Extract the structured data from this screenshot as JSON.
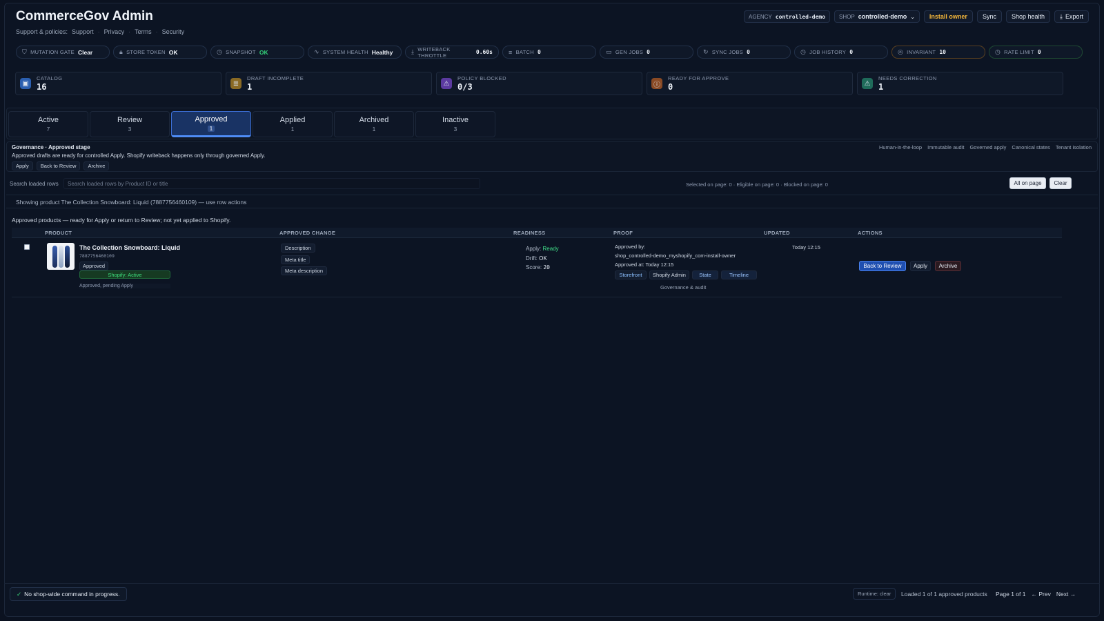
{
  "app": {
    "title": "CommerceGov Admin",
    "support_label": "Support & policies:",
    "support_links": [
      "Support",
      "Privacy",
      "Terms",
      "Security"
    ]
  },
  "header": {
    "agency_label": "AGENCY",
    "agency_value": "controlled-demo",
    "shop_label": "SHOP",
    "shop_value": "controlled-demo",
    "install_owner": "Install owner",
    "sync": "Sync",
    "shop_health": "Shop health",
    "export": "Export"
  },
  "status_chips": [
    {
      "label": "MUTATION GATE",
      "value": "Clear",
      "icon": "shield-icon",
      "style": "plain"
    },
    {
      "label": "STORE TOKEN",
      "value": "OK",
      "icon": "lock-icon",
      "style": "plain"
    },
    {
      "label": "SNAPSHOT",
      "value": "OK",
      "icon": "clock-icon",
      "style": "ok"
    },
    {
      "label": "SYSTEM HEALTH",
      "value": "Healthy",
      "icon": "pulse-icon",
      "style": "plain"
    },
    {
      "label": "WRITEBACK THROTTLE",
      "value": "0.60s",
      "icon": "download-icon",
      "style": "mono"
    },
    {
      "label": "BATCH",
      "value": "0",
      "icon": "list-icon",
      "style": "mono"
    },
    {
      "label": "GEN JOBS",
      "value": "0",
      "icon": "briefcase-icon",
      "style": "mono"
    },
    {
      "label": "SYNC JOBS",
      "value": "0",
      "icon": "refresh-icon",
      "style": "mono"
    },
    {
      "label": "JOB HISTORY",
      "value": "0",
      "icon": "clock-icon",
      "style": "mono"
    },
    {
      "label": "INVARIANT",
      "value": "10",
      "icon": "check-circle-icon",
      "style": "mono"
    },
    {
      "label": "RATE LIMIT",
      "value": "0",
      "icon": "clock-icon",
      "style": "mono"
    }
  ],
  "metrics": [
    {
      "label": "CATALOG",
      "value": "16",
      "icon": "bag-icon",
      "color": "#2b5fb0"
    },
    {
      "label": "DRAFT INCOMPLETE",
      "value": "1",
      "icon": "doc-icon",
      "color": "#8a6a24"
    },
    {
      "label": "POLICY BLOCKED",
      "value": "0/3",
      "icon": "warning-icon",
      "color": "#5b3aa0"
    },
    {
      "label": "READY FOR APPROVE",
      "value": "0",
      "icon": "alert-circle-icon",
      "color": "#8a4a24"
    },
    {
      "label": "NEEDS CORRECTION",
      "value": "1",
      "icon": "warning-icon",
      "color": "#1f6b5a"
    }
  ],
  "tabs": [
    {
      "label": "Active",
      "count": "7"
    },
    {
      "label": "Review",
      "count": "3"
    },
    {
      "label": "Approved",
      "count": "1"
    },
    {
      "label": "Applied",
      "count": "1"
    },
    {
      "label": "Archived",
      "count": "1"
    },
    {
      "label": "Inactive",
      "count": "3"
    }
  ],
  "governance": {
    "title": "Governance · Approved stage",
    "description": "Approved drafts are ready for controlled Apply. Shopify writeback happens only through governed Apply.",
    "actions": [
      "Apply",
      "Back to Review",
      "Archive"
    ],
    "tags": [
      "Human-in-the-loop",
      "Immutable audit",
      "Governed apply",
      "Canonical states",
      "Tenant isolation"
    ]
  },
  "search": {
    "label": "Search loaded rows",
    "placeholder": "Search loaded rows by Product ID or title",
    "value": "",
    "selection_info": "Selected on page: 0 · Eligible on page: 0 · Blocked on page: 0",
    "all_on_page": "All on page",
    "clear": "Clear"
  },
  "showing_text": "Showing product The Collection Snowboard: Liquid (7887756460109) — use row actions",
  "approved_note": "Approved products — ready for Apply or return to Review; not yet applied to Shopify.",
  "table": {
    "headers": [
      "PRODUCT",
      "APPROVED CHANGE",
      "READINESS",
      "PROOF",
      "UPDATED",
      "ACTIONS"
    ],
    "rows": [
      {
        "name": "The Collection Snowboard: Liquid",
        "id": "7887756460109",
        "badge": "Approved",
        "shopify": "Shopify: Active",
        "pending": "Approved, pending Apply",
        "changes": [
          "Description",
          "Meta title",
          "Meta description"
        ],
        "readiness": {
          "apply_label": "Apply:",
          "apply": "Ready",
          "drift_label": "Drift:",
          "drift": "OK",
          "score_label": "Score:",
          "score": "20"
        },
        "proof": {
          "approved_by_label": "Approved by:",
          "approved_by": "shop_controlled-demo_myshopify_com-install-owner",
          "approved_at": "Approved at: Today 12:15",
          "chips": [
            "Storefront",
            "Shopify Admin",
            "State",
            "Timeline"
          ],
          "audit": "Governance & audit"
        },
        "updated": "Today 12:15",
        "actions": [
          "Back to Review",
          "Apply",
          "Archive"
        ]
      }
    ]
  },
  "footer": {
    "status": "No shop-wide command in progress.",
    "runtime": "Runtime: clear",
    "loaded": "Loaded 1 of 1 approved products",
    "page": "Page 1 of 1",
    "prev": "← Prev",
    "next": "Next →"
  }
}
